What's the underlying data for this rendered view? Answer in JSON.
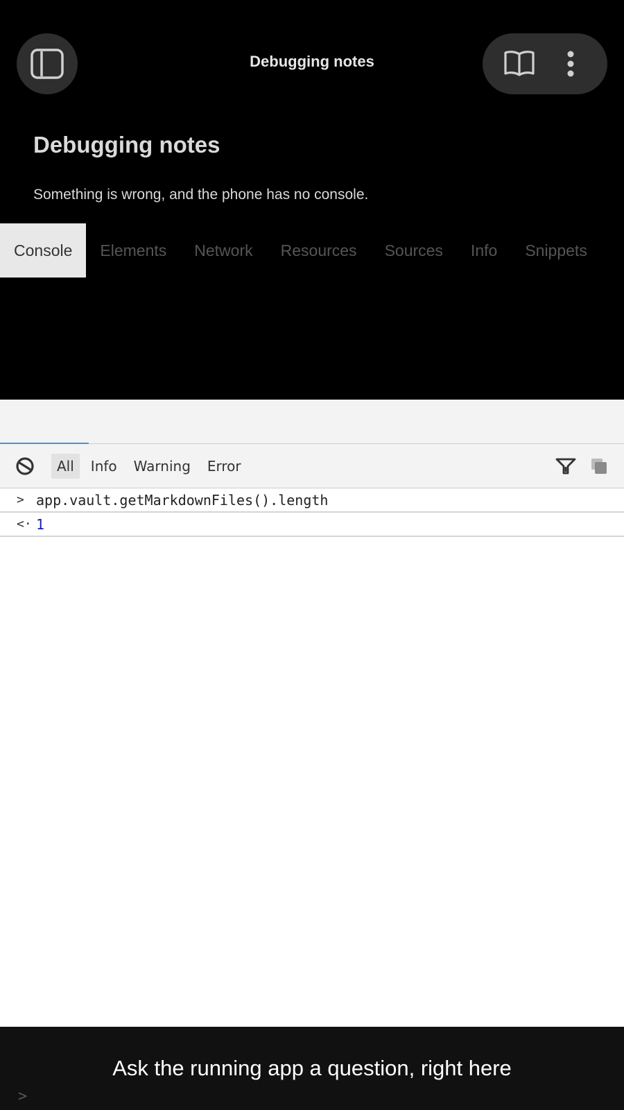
{
  "topbar": {
    "title": "Debugging notes",
    "sidebar_toggle_icon": "sidebar-toggle-icon",
    "reading_view_icon": "open-book-icon",
    "more_icon": "more-vertical-icon"
  },
  "note": {
    "title": "Debugging notes",
    "body": "Something is wrong, and the phone has no console."
  },
  "devtools": {
    "tabs": [
      {
        "label": "Console"
      },
      {
        "label": "Elements"
      },
      {
        "label": "Network"
      },
      {
        "label": "Resources"
      },
      {
        "label": "Sources"
      },
      {
        "label": "Info"
      },
      {
        "label": "Snippets"
      }
    ],
    "active_tab": "Console"
  },
  "console": {
    "levels": [
      {
        "label": "All"
      },
      {
        "label": "Info"
      },
      {
        "label": "Warning"
      },
      {
        "label": "Error"
      }
    ],
    "active_level": "All",
    "entries": [
      {
        "prompt": ">",
        "text": "app.vault.getMarkdownFiles().length"
      },
      {
        "prompt": "<·",
        "text": "1"
      }
    ],
    "input_prompt": ">"
  },
  "caption": "Ask the running app a question, right here",
  "colors": {
    "background": "#000000",
    "pill": "#2e2e2e",
    "active_tab": "#e8e8e8",
    "result_blue": "#1a1aa6",
    "tab_underline": "#4a90d9"
  }
}
